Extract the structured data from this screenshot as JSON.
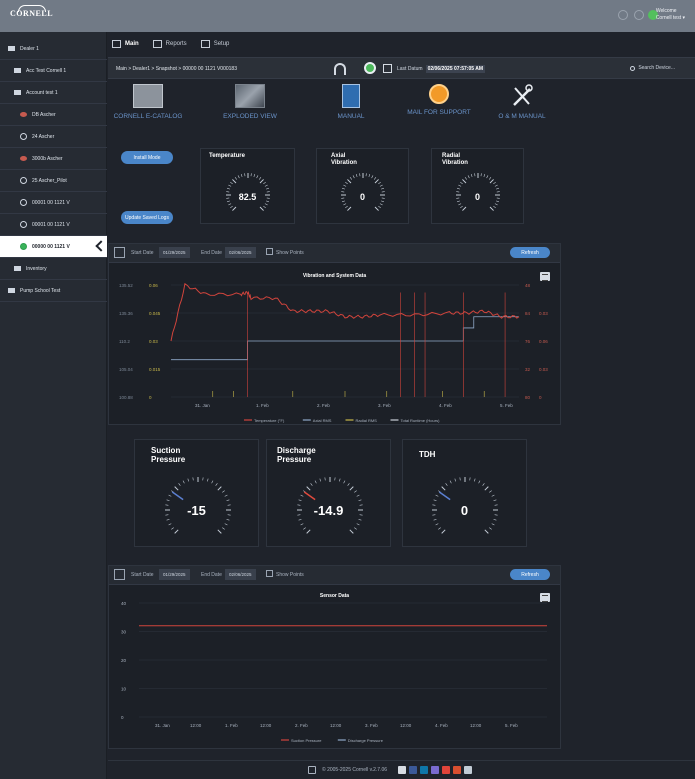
{
  "header": {
    "logo_text": "CORNELL",
    "welcome_line1": "Welcome",
    "welcome_line2": "Cornell test ▾"
  },
  "sidebar": {
    "items": [
      {
        "label": "Dealer 1"
      },
      {
        "label": "Acc Test Cornell 1"
      },
      {
        "label": "Account test 1"
      },
      {
        "label": "DB Ascher"
      },
      {
        "label": "24 Ascher"
      },
      {
        "label": "3000b Ascher"
      },
      {
        "label": "25 Ascher_Pilot"
      },
      {
        "label": "00001 00 1121 V"
      },
      {
        "label": "00001 00 1121 V"
      },
      {
        "label": "00000 00 1121 V"
      },
      {
        "label": "Inventory"
      },
      {
        "label": "Pump School Test"
      }
    ]
  },
  "tabs": [
    {
      "label": "Main"
    },
    {
      "label": "Reports"
    },
    {
      "label": "Setup"
    }
  ],
  "breadcrumb": {
    "text": "Main  >  Dealer1  >  Snapshot  >  00000 00 1121 V000183",
    "last_data_label": "Last Datum",
    "last_data_value": "02/06/2025 07:57:05 AM",
    "search_placeholder": "Search Device..."
  },
  "documents": [
    {
      "label": "CORNELL E-CATALOG",
      "icon": "catalog-icon"
    },
    {
      "label": "EXPLODED VIEW",
      "icon": "exploded-view-icon"
    },
    {
      "label": "MANUAL",
      "icon": "manual-icon"
    },
    {
      "label": "MAIL FOR SUPPORT",
      "icon": "mail-icon"
    },
    {
      "label": "O & M MANUAL",
      "icon": "tools-icon"
    }
  ],
  "buttons": {
    "install": "Install Mode",
    "update": "Update Saved Logs"
  },
  "top_gauges": [
    {
      "title_line1": "Temperature",
      "title_line2": "",
      "value": "82.5"
    },
    {
      "title_line1": "Axial",
      "title_line2": "Vibration",
      "value": "0"
    },
    {
      "title_line1": "Radial",
      "title_line2": "Vibration",
      "value": "0"
    }
  ],
  "pressure_gauges": [
    {
      "title_line1": "Suction",
      "title_line2": "Pressure",
      "value": "-15"
    },
    {
      "title_line1": "Discharge",
      "title_line2": "Pressure",
      "value": "-14.9"
    },
    {
      "title_line1": "TDH",
      "title_line2": "",
      "value": "0"
    }
  ],
  "filters": {
    "start_label": "Start Date",
    "start_value1": "01/29/2025",
    "end_label": "End Date",
    "end_value1": "02/06/2025",
    "start_value2": "01/29/2025",
    "end_value2": "02/06/2025",
    "show_points": "Show Points",
    "refresh": "Refresh"
  },
  "colors": {
    "accent": "#4a86c9",
    "temperature": "#d0443c",
    "axial": "#8fa8c8",
    "radial": "#c8b84a",
    "runtime": "#c9cfd8"
  },
  "chart_data": [
    {
      "type": "line",
      "title": "Vibration and System Data",
      "x_ticks": [
        "31. Jan",
        "1. Feb",
        "2. Feb",
        "3. Feb",
        "4. Feb",
        "5. Feb"
      ],
      "left_axis_temp": [
        "135.52",
        "135.36",
        "110.2",
        "105.04",
        "100.88"
      ],
      "left_axis_vib": [
        "0.06",
        "0.045",
        "0.03",
        "0.015",
        "0"
      ],
      "right_axis_temp": [
        "48",
        "84",
        "76",
        "32",
        "80"
      ],
      "right_axis_vib": [
        "",
        "0.03",
        "0.06",
        "0.03",
        "0"
      ],
      "legend": [
        "Temperature (°F)",
        "Axial RMS",
        "Radial RMS",
        "Total Runtime (Hours)"
      ],
      "series": [
        {
          "name": "Temperature (°F)",
          "x": [
            0.0,
            0.04,
            0.1,
            0.2,
            0.22,
            0.23,
            0.3,
            0.35,
            0.4,
            0.45,
            0.5,
            0.55,
            0.6,
            0.7,
            0.8,
            0.85,
            0.9,
            0.95,
            1.0
          ],
          "values": [
            0.03,
            0.06,
            0.055,
            0.055,
            0.056,
            0.053,
            0.053,
            0.046,
            0.046,
            0.046,
            0.043,
            0.043,
            0.044,
            0.044,
            0.045,
            0.045,
            0.046,
            0.043,
            0.043
          ]
        },
        {
          "name": "Total Runtime (Hours)",
          "x": [
            0.0,
            0.22,
            0.22,
            0.84,
            0.84,
            0.87,
            0.87,
            1.0
          ],
          "values": [
            0.02,
            0.02,
            0.03,
            0.03,
            0.037,
            0.037,
            0.043,
            0.043
          ]
        }
      ]
    },
    {
      "type": "line",
      "title": "Sensor Data",
      "x_ticks": [
        "31. Jan",
        "12:00",
        "1. Feb",
        "12:00",
        "2. Feb",
        "12:00",
        "3. Feb",
        "12:00",
        "4. Feb",
        "12:00",
        "5. Feb"
      ],
      "y_ticks": [
        "40",
        "30",
        "20",
        "10",
        "0"
      ],
      "ylim": [
        0,
        40
      ],
      "legend": [
        "Suction Pressure",
        "Discharge Pressure"
      ],
      "series": [
        {
          "name": "Suction Pressure",
          "values": [
            32,
            32
          ]
        },
        {
          "name": "Discharge Pressure",
          "values": [
            32,
            32
          ]
        }
      ]
    }
  ],
  "footer": {
    "copyright": "© 2005-2025   Cornell   v.2.7.06"
  }
}
